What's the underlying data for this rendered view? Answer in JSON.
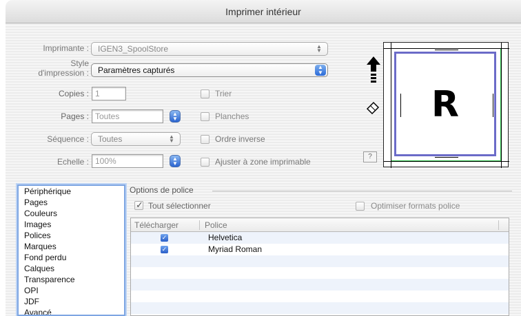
{
  "window": {
    "title": "Imprimer intérieur"
  },
  "printer": {
    "label": "Imprimante :",
    "value": "IGEN3_SpoolStore"
  },
  "style": {
    "label_line1": "Style",
    "label_line2": "d'impression :",
    "value": "Paramètres capturés"
  },
  "copies": {
    "label": "Copies :",
    "value": "1"
  },
  "pages": {
    "label": "Pages :",
    "value": "Toutes"
  },
  "sequence": {
    "label": "Séquence :",
    "value": "Toutes"
  },
  "scale": {
    "label": "Echelle :",
    "value": "100%"
  },
  "checkboxes": {
    "collate": "Trier",
    "spreads": "Planches",
    "reverse": "Ordre inverse",
    "fit": "Ajuster à zone imprimable"
  },
  "preview": {
    "letter": "R",
    "help": "?"
  },
  "sidebar": {
    "items": [
      {
        "label": "Périphérique"
      },
      {
        "label": "Pages"
      },
      {
        "label": "Couleurs"
      },
      {
        "label": "Images"
      },
      {
        "label": "Polices"
      },
      {
        "label": "Marques"
      },
      {
        "label": "Fond perdu"
      },
      {
        "label": "Calques"
      },
      {
        "label": "Transparence"
      },
      {
        "label": "OPI"
      },
      {
        "label": "JDF"
      },
      {
        "label": "Avancé"
      }
    ]
  },
  "fonts_panel": {
    "title": "Options de police",
    "select_all": "Tout sélectionner",
    "optimize": "Optimiser formats police",
    "columns": {
      "download": "Télécharger",
      "font": "Police"
    },
    "rows": [
      {
        "checked": true,
        "name": "Helvetica"
      },
      {
        "checked": true,
        "name": "Myriad Roman"
      }
    ]
  },
  "icons": {
    "updown": "up-down-arrows",
    "check": "checkmark"
  }
}
